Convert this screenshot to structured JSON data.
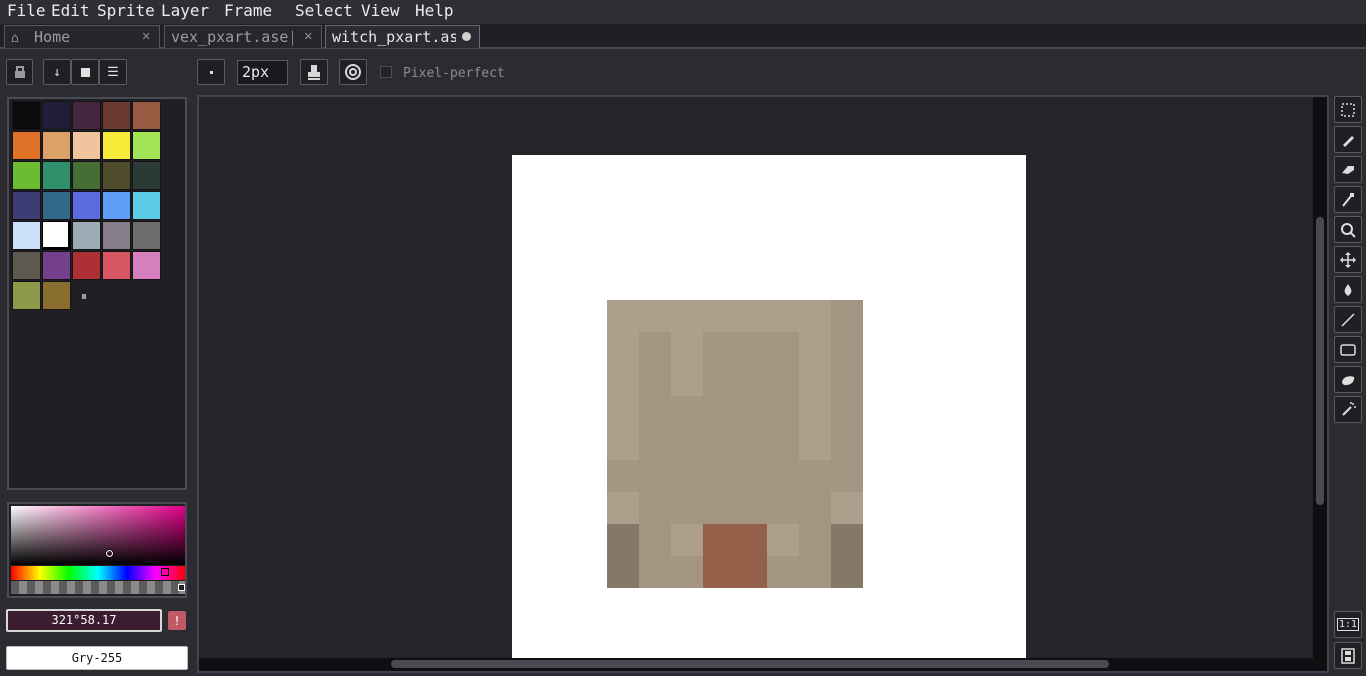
{
  "menu": [
    "File",
    "Edit",
    "Sprite",
    "Layer",
    "Frame",
    "Select",
    "View",
    "Help"
  ],
  "tabs": [
    {
      "label": "Home",
      "icon": "home-icon",
      "closable": true
    },
    {
      "label": "vex_pxart.ase|",
      "closable": true
    },
    {
      "label": "witch_pxart.as",
      "modified": true,
      "active": true
    }
  ],
  "toolbar": {
    "brush_size": "2px",
    "pixel_perfect_label": "Pixel-perfect",
    "pixel_perfect_checked": false
  },
  "palette": {
    "colors": [
      "#0b0b0d",
      "#221e38",
      "#46263e",
      "#6a3a32",
      "#985c42",
      "#e07228",
      "#dca268",
      "#f0c49c",
      "#f8ea38",
      "#a2e456",
      "#6cbc32",
      "#31906c",
      "#466e34",
      "#4e4c2a",
      "#2c3a36",
      "#3e3c74",
      "#306a88",
      "#5a6ce0",
      "#5e9ef8",
      "#5ecce4",
      "#cce0fc",
      "#ffffff",
      "#9cacb4",
      "#867e88",
      "#6c6c6c",
      "#5e5a50",
      "#74408c",
      "#ac3034",
      "#d85662",
      "#d680c0",
      "#8e9a4a",
      "#8a6e30"
    ],
    "selected_index": 21
  },
  "color": {
    "hsv_value": "321°58.17",
    "name": "Gry-255",
    "base_hue": "#e0008a"
  },
  "sprite": {
    "background": "#ffffff",
    "colors": {
      "light": "#aca08c",
      "mid": "#a49482",
      "dark": "#867866",
      "brown": "#94604a"
    }
  },
  "right_tools": [
    "rectangular-marquee-icon",
    "pencil-icon",
    "eraser-icon",
    "eyedropper-icon",
    "zoom-icon",
    "move-icon",
    "paint-bucket-icon",
    "line-icon",
    "rectangle-icon",
    "contour-icon",
    "spray-icon"
  ],
  "bottom_tools": {
    "zoom_label": "1:1"
  }
}
